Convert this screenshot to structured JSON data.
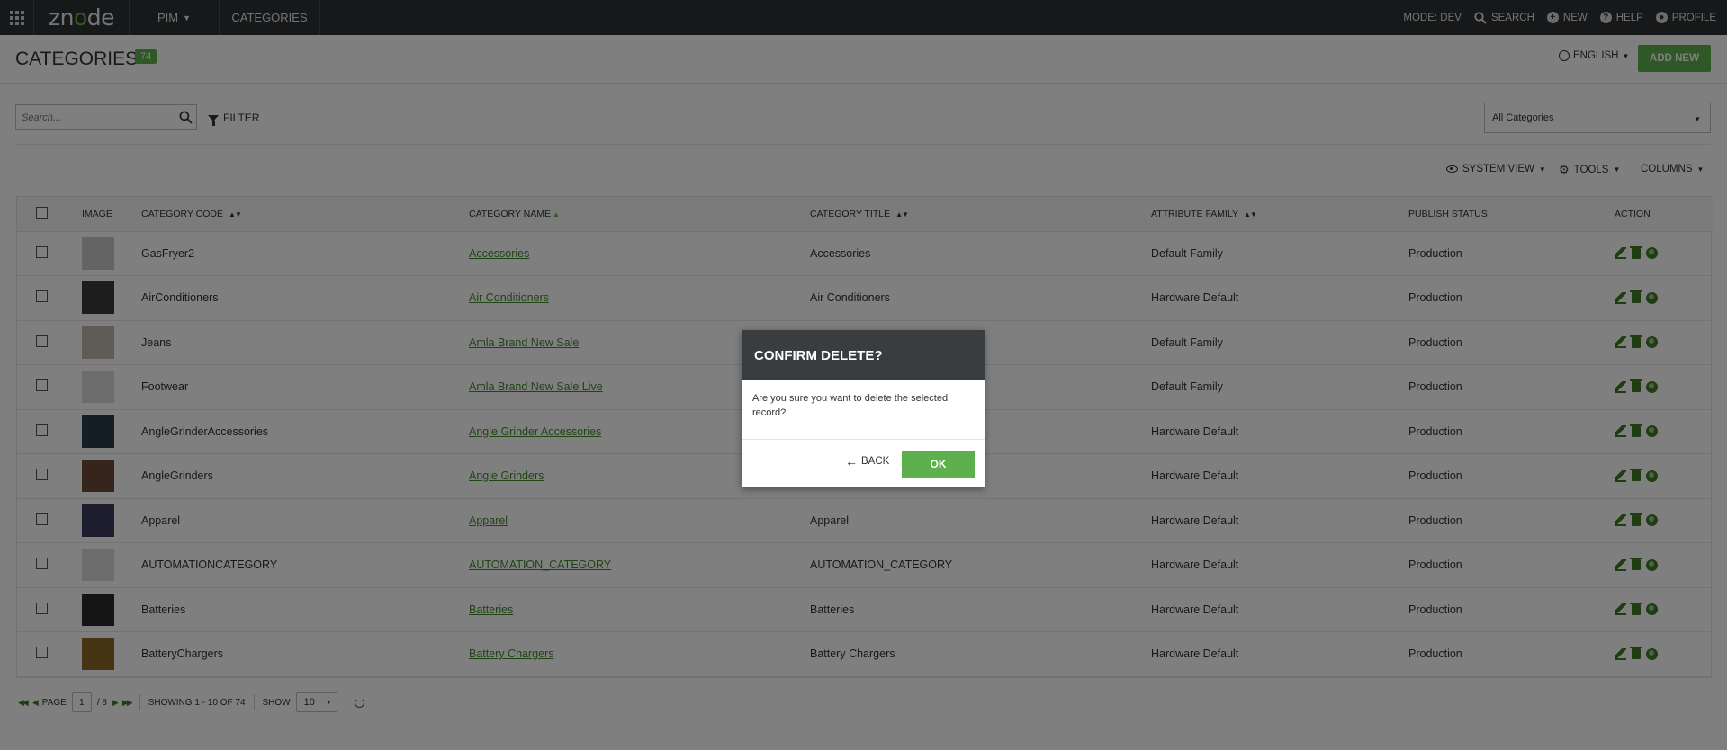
{
  "topbar": {
    "logo_text": "znode",
    "nav": {
      "pim_label": "PIM",
      "categories_label": "CATEGORIES"
    },
    "mode_label": "MODE: DEV",
    "search_label": "SEARCH",
    "new_label": "NEW",
    "help_label": "HELP",
    "profile_label": "PROFILE"
  },
  "header": {
    "title": "CATEGORIES",
    "count": "74",
    "language": "ENGLISH",
    "add_new_label": "ADD NEW"
  },
  "search": {
    "placeholder": "Search...",
    "filter_label": "FILTER"
  },
  "category_select": {
    "value": "All Categories"
  },
  "grid_toolbar": {
    "system_view": "SYSTEM VIEW",
    "tools": "TOOLS",
    "columns": "COLUMNS"
  },
  "table": {
    "columns": [
      "IMAGE",
      "CATEGORY CODE",
      "CATEGORY NAME",
      "CATEGORY TITLE",
      "ATTRIBUTE FAMILY",
      "PUBLISH STATUS",
      "ACTION"
    ],
    "rows": [
      {
        "code": "GasFryer2",
        "name": "Accessories",
        "title": "Accessories",
        "family": "Default Family",
        "status": "Production",
        "thumb": "#c8c8c8"
      },
      {
        "code": "AirConditioners",
        "name": "Air Conditioners",
        "title": "Air Conditioners",
        "family": "Hardware Default",
        "status": "Production",
        "thumb": "#3a3a3a"
      },
      {
        "code": "Jeans",
        "name": "Amla Brand New Sale",
        "title": "",
        "family": "Default Family",
        "status": "Production",
        "thumb": "#bdb8a8"
      },
      {
        "code": "Footwear",
        "name": "Amla Brand New Sale Live",
        "title": "",
        "family": "Default Family",
        "status": "Production",
        "thumb": "#d8d8d8"
      },
      {
        "code": "AngleGrinderAccessories",
        "name": "Angle Grinder Accessories",
        "title": "",
        "family": "Hardware Default",
        "status": "Production",
        "thumb": "#2a3a4a"
      },
      {
        "code": "AngleGrinders",
        "name": "Angle Grinders",
        "title": "",
        "family": "Hardware Default",
        "status": "Production",
        "thumb": "#6a4a3a"
      },
      {
        "code": "Apparel",
        "name": "Apparel",
        "title": "Apparel",
        "family": "Hardware Default",
        "status": "Production",
        "thumb": "#3a3a5a"
      },
      {
        "code": "AUTOMATIONCATEGORY",
        "name": "AUTOMATION_CATEGORY",
        "title": "AUTOMATION_CATEGORY",
        "family": "Hardware Default",
        "status": "Production",
        "thumb": "#d8d8d8"
      },
      {
        "code": "Batteries",
        "name": "Batteries",
        "title": "Batteries",
        "family": "Hardware Default",
        "status": "Production",
        "thumb": "#2a2a2a"
      },
      {
        "code": "BatteryChargers",
        "name": "Battery Chargers",
        "title": "Battery Chargers",
        "family": "Hardware Default",
        "status": "Production",
        "thumb": "#8a6a2a"
      }
    ]
  },
  "pager": {
    "page_label": "PAGE",
    "page": "1",
    "total_pages": "/ 8",
    "showing": "SHOWING 1 - 10 OF 74",
    "show_label": "SHOW",
    "page_size": "10"
  },
  "modal": {
    "title": "CONFIRM DELETE?",
    "message": "Are you sure you want to delete the selected record?",
    "back_label": "BACK",
    "ok_label": "OK"
  },
  "colors": {
    "accent": "#5db04c",
    "topbar": "#2f3133",
    "link": "#3f8a2b",
    "modal_header": "#3a3d40"
  }
}
